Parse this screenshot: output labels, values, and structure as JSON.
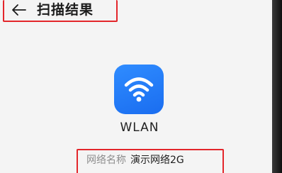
{
  "header": {
    "title": "扫描结果"
  },
  "app": {
    "name": "WLAN",
    "icon": "wifi-icon",
    "icon_color": "#1f7bf6"
  },
  "details": {
    "network_name_label": "网络名称",
    "network_name_value": "演示网络2G"
  },
  "colors": {
    "highlight": "#e3262b"
  }
}
